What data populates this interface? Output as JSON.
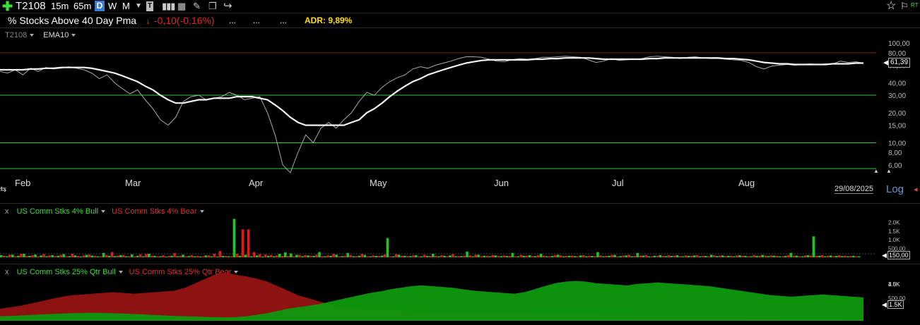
{
  "toolbar": {
    "symbol": "T2108",
    "timeframes": [
      "15m",
      "65m"
    ],
    "periods": [
      "D",
      "W",
      "M"
    ],
    "active_period": "D",
    "icons": [
      "plus-icon",
      "dropdown-icon",
      "indicator-icon",
      "bar-chart-icon",
      "calculator-icon",
      "pencil-icon",
      "notes-icon",
      "share-icon",
      "star-icon",
      "flag-icon"
    ],
    "rt_label": "RT"
  },
  "header": {
    "title": "% Stocks Above 40 Day Pma",
    "change": "-0,10(-0,16%)",
    "dots": [
      "...",
      "...",
      "..."
    ],
    "adr": "ADR: 9,89%"
  },
  "main_pane": {
    "legend": [
      "T2108",
      "EMA10"
    ],
    "last_value": "61,39",
    "date_label": "29/08/2025",
    "scale_label": "Log",
    "months": [
      "Feb",
      "Mar",
      "Apr",
      "May",
      "Jun",
      "Jul",
      "Aug"
    ]
  },
  "pane2": {
    "close": "x",
    "legend_bull": "US Comm Stks 4% Bull",
    "legend_bear": "US Comm Stks 4% Bear",
    "ticks": [
      "2.0K",
      "1.5K",
      "1.0K",
      "500,00"
    ],
    "last_value": "150,00"
  },
  "pane3": {
    "close": "x",
    "legend_bull": "US Comm Stks 25% Qtr Bull",
    "legend_bear": "US Comm Stks 25% Qtr Bear",
    "ticks": [
      "4.0K",
      "3.5K",
      "3.0K",
      "2.5K",
      "500,00"
    ],
    "last_value": "1.5K"
  },
  "colors": {
    "bull": "#22c322",
    "bear": "#d42020",
    "area_bull": "#0e9a0e",
    "area_bear": "#8d1212",
    "area_bear_low": "#8a5a10",
    "price": "#a9a9a9",
    "ema": "#f2f2f2",
    "hline_red": "#7a1f1f",
    "hline_green": "#2ecc40"
  },
  "chart_data": [
    {
      "type": "line",
      "title": "% Stocks Above 40 Day Pma",
      "y_scale": "log",
      "ylim": [
        5,
        120
      ],
      "y_ticks": [
        "100,00",
        "80,00",
        "60,00",
        "40,00",
        "30,00",
        "20,00",
        "15,00",
        "10,00",
        "8,00",
        "6,00"
      ],
      "x_ticks": [
        "Feb",
        "Mar",
        "Apr",
        "May",
        "Jun",
        "Jul",
        "Aug"
      ],
      "horizontal_lines": [
        80,
        30,
        10,
        5.5
      ],
      "series": [
        {
          "name": "T2108",
          "values": [
            52,
            50,
            54,
            48,
            56,
            52,
            57,
            55,
            56,
            58,
            56,
            54,
            50,
            44,
            48,
            40,
            35,
            31,
            34,
            27,
            22,
            17,
            15,
            18,
            26,
            29,
            30,
            27,
            28,
            29,
            32,
            30,
            27,
            28,
            29,
            20,
            12,
            6,
            5,
            8,
            12,
            10,
            14,
            16,
            14,
            17,
            20,
            26,
            32,
            30,
            36,
            41,
            45,
            48,
            55,
            58,
            56,
            60,
            63,
            66,
            70,
            73,
            73,
            72,
            69,
            66,
            65,
            68,
            70,
            69,
            70,
            72,
            72,
            73,
            74,
            73,
            72,
            68,
            64,
            66,
            70,
            67,
            68,
            69,
            70,
            73,
            74,
            73,
            72,
            70,
            72,
            73,
            71,
            70,
            70,
            69,
            68,
            67,
            64,
            58,
            55,
            59,
            60,
            61,
            60,
            61,
            62,
            61,
            62,
            62,
            66,
            64,
            65,
            63
          ]
        },
        {
          "name": "EMA10",
          "values": [
            54,
            54,
            54,
            54,
            55,
            55,
            56,
            56,
            57,
            57,
            57,
            57,
            56,
            54,
            52,
            50,
            47,
            44,
            41,
            37,
            34,
            30,
            27,
            25,
            25,
            26,
            27,
            27,
            28,
            28,
            28,
            29,
            29,
            29,
            28,
            27,
            24,
            21,
            18,
            16,
            15,
            15,
            15,
            15,
            15,
            15,
            16,
            17,
            20,
            22,
            25,
            29,
            33,
            37,
            41,
            44,
            48,
            51,
            54,
            57,
            60,
            63,
            65,
            67,
            68,
            68,
            68,
            68,
            68,
            68,
            69,
            69,
            70,
            70,
            71,
            71,
            71,
            71,
            70,
            69,
            69,
            69,
            69,
            69,
            69,
            70,
            70,
            71,
            71,
            71,
            71,
            71,
            71,
            71,
            71,
            70,
            70,
            69,
            68,
            66,
            64,
            63,
            62,
            62,
            61,
            61,
            61,
            61,
            61,
            62,
            62,
            62,
            63,
            63
          ]
        }
      ]
    },
    {
      "type": "bar",
      "ylim": [
        0,
        2500
      ],
      "y_ticks": [
        2000,
        1500,
        1000,
        500
      ],
      "series": [
        {
          "name": "US Comm Stks 4% Bull",
          "values": [
            120,
            60,
            150,
            90,
            200,
            80,
            160,
            110,
            60,
            130,
            90,
            180,
            70,
            110,
            50,
            140,
            100,
            60,
            250,
            90,
            70,
            130,
            60,
            170,
            90,
            60,
            200,
            80,
            60,
            40,
            90,
            60,
            150,
            70,
            60,
            50,
            110,
            60,
            40,
            80,
            60,
            2200,
            90,
            150,
            60,
            110,
            50,
            90,
            60,
            200,
            280,
            220,
            140,
            60,
            110,
            80,
            300,
            60,
            90,
            150,
            70,
            250,
            60,
            90,
            140,
            60,
            80,
            100,
            1100,
            60,
            150,
            90,
            70,
            120,
            60,
            80,
            200,
            60,
            90,
            110,
            60,
            70,
            330,
            60,
            150,
            90,
            60,
            110,
            70,
            80,
            250,
            60,
            90,
            120,
            70,
            200,
            60,
            80,
            150,
            60,
            90,
            70,
            110,
            60,
            80,
            300,
            60,
            90,
            140,
            70,
            110,
            60,
            250,
            100,
            60,
            90,
            130,
            70,
            80,
            120,
            60,
            90,
            110,
            60,
            80,
            150,
            70,
            110,
            90,
            60,
            120,
            80,
            60,
            90,
            140,
            70,
            100,
            60,
            80,
            250,
            100,
            60,
            120,
            1200,
            90,
            60,
            110,
            80,
            70,
            60,
            90,
            60
          ]
        },
        {
          "name": "US Comm Stks 4% Bear",
          "values": [
            90,
            150,
            60,
            200,
            80,
            120,
            60,
            180,
            110,
            70,
            140,
            60,
            200,
            80,
            110,
            160,
            90,
            60,
            140,
            300,
            100,
            130,
            70,
            60,
            170,
            180,
            90,
            60,
            120,
            80,
            240,
            90,
            60,
            130,
            80,
            60,
            110,
            200,
            360,
            80,
            60,
            200,
            1600,
            1600,
            300,
            180,
            160,
            130,
            110,
            80,
            80,
            60,
            140,
            120,
            90,
            150,
            70,
            110,
            200,
            60,
            90,
            130,
            70,
            200,
            60,
            110,
            80,
            160,
            60,
            180,
            90,
            70,
            110,
            60,
            150,
            80,
            90,
            120,
            60,
            180,
            70,
            90,
            110,
            150,
            60,
            90,
            130,
            70,
            110,
            80,
            60,
            140,
            90,
            70,
            120,
            100,
            60,
            130,
            110,
            80,
            100,
            60,
            120,
            90,
            70,
            110,
            80,
            140,
            60,
            100,
            150,
            80,
            110,
            130,
            60,
            90,
            80,
            120,
            100,
            70,
            110,
            90,
            130,
            80,
            60,
            120,
            100,
            70,
            90,
            110,
            80,
            60,
            130,
            90,
            100,
            110,
            80,
            60,
            120,
            90,
            70,
            110,
            100,
            80,
            130,
            90,
            60,
            120,
            90,
            80,
            60
          ]
        }
      ]
    },
    {
      "type": "area",
      "ylim": [
        0,
        4500
      ],
      "y_ticks": [
        4000,
        3500,
        3000,
        2500,
        1500,
        500
      ],
      "series": [
        {
          "name": "US Comm Stks 25% Qtr Bull",
          "values": [
            300,
            320,
            350,
            380,
            420,
            450,
            480,
            500,
            520,
            530,
            520,
            500,
            480,
            450,
            420,
            380,
            350,
            320,
            300,
            280,
            260,
            240,
            230,
            250,
            300,
            400,
            500,
            650,
            800,
            900,
            1000,
            1100,
            1250,
            1400,
            1550,
            1700,
            1850,
            1950,
            2100,
            2200,
            2300,
            2350,
            2300,
            2250,
            2200,
            2100,
            2000,
            1950,
            1900,
            1850,
            1800,
            1900,
            2100,
            2300,
            2500,
            2600,
            2650,
            2600,
            2500,
            2450,
            2400,
            2350,
            2450,
            2500,
            2550,
            2500,
            2450,
            2400,
            2350,
            2300,
            2200,
            2100,
            2000,
            1900,
            1800,
            1700,
            1650,
            1600,
            1650,
            1700,
            1750,
            1700,
            1650,
            1600,
            1550
          ]
        },
        {
          "name": "US Comm Stks 25% Qtr Bear",
          "values": [
            800,
            900,
            1000,
            1150,
            1300,
            1450,
            1600,
            1700,
            1750,
            1800,
            1850,
            1900,
            1850,
            1800,
            1850,
            1900,
            1950,
            2000,
            2200,
            2500,
            2800,
            3100,
            3200,
            3050,
            2950,
            2800,
            2600,
            2300,
            2000,
            1700,
            1500,
            1300,
            1100,
            950,
            850,
            780,
            720,
            680,
            650,
            640,
            620,
            600,
            580,
            560,
            550,
            540,
            530,
            520,
            510,
            500,
            490,
            480,
            470,
            460,
            450,
            440,
            430,
            420,
            410,
            400,
            400,
            390,
            380,
            370,
            360,
            350,
            340,
            330,
            320,
            310,
            300,
            300,
            290,
            280,
            270,
            260,
            250,
            250,
            240,
            230,
            220,
            210,
            200,
            200,
            190
          ]
        }
      ]
    }
  ]
}
